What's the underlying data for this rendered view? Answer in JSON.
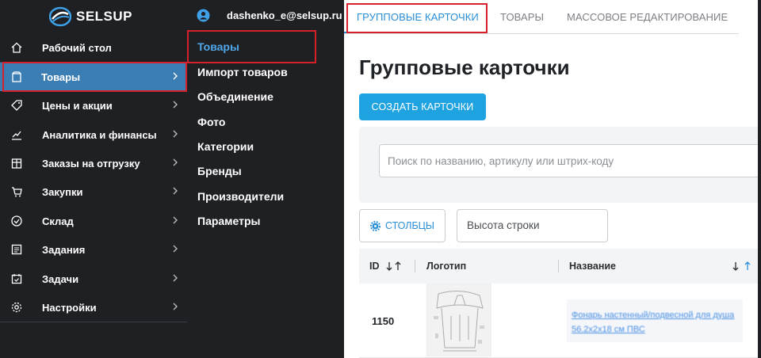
{
  "brand": {
    "logo_text": "SELSUP"
  },
  "user": {
    "email": "dashenko_e@selsup.ru"
  },
  "sidebar": {
    "items": [
      {
        "label": "Рабочий стол",
        "icon": "home-icon",
        "chevron": false
      },
      {
        "label": "Товары",
        "icon": "box-icon",
        "chevron": true,
        "active": true
      },
      {
        "label": "Цены и акции",
        "icon": "tag-icon",
        "chevron": true
      },
      {
        "label": "Аналитика и финансы",
        "icon": "chart-line-icon",
        "chevron": true
      },
      {
        "label": "Заказы на отгрузку",
        "icon": "package-icon",
        "chevron": true
      },
      {
        "label": "Закупки",
        "icon": "cart-icon",
        "chevron": true
      },
      {
        "label": "Склад",
        "icon": "check-circle-icon",
        "chevron": true
      },
      {
        "label": "Задания",
        "icon": "list-icon",
        "chevron": true
      },
      {
        "label": "Задачи",
        "icon": "calendar-check-icon",
        "chevron": true
      },
      {
        "label": "Настройки",
        "icon": "gear-icon",
        "chevron": true
      }
    ]
  },
  "submenu": {
    "items": [
      {
        "label": "Товары",
        "active": true
      },
      {
        "label": "Импорт товаров"
      },
      {
        "label": "Объединение"
      },
      {
        "label": "Фото"
      },
      {
        "label": "Категории"
      },
      {
        "label": "Бренды"
      },
      {
        "label": "Производители"
      },
      {
        "label": "Параметры"
      }
    ]
  },
  "tabs": [
    {
      "label": "ГРУППОВЫЕ КАРТОЧКИ",
      "active": true
    },
    {
      "label": "ТОВАРЫ"
    },
    {
      "label": "МАССОВОЕ РЕДАКТИРОВАНИЕ"
    }
  ],
  "page": {
    "title": "Групповые карточки",
    "create_button": "СОЗДАТЬ КАРТОЧКИ",
    "search_placeholder": "Поиск по названию, артикулу или штрих-коду",
    "columns_button": "СТОЛБЦЫ",
    "row_height_label": "Высота строки"
  },
  "table": {
    "headers": {
      "id": "ID",
      "logo": "Логотип",
      "name": "Название"
    },
    "rows": [
      {
        "id": "1150",
        "name": "Фонарь настенный/подвесной для душа 56.2x2x18 см ПВС"
      }
    ]
  },
  "colors": {
    "sidebar_bg": "#1e2023",
    "active_item": "#3b7eb4",
    "accent": "#1ea3e0",
    "highlight_box": "#d6212a"
  }
}
